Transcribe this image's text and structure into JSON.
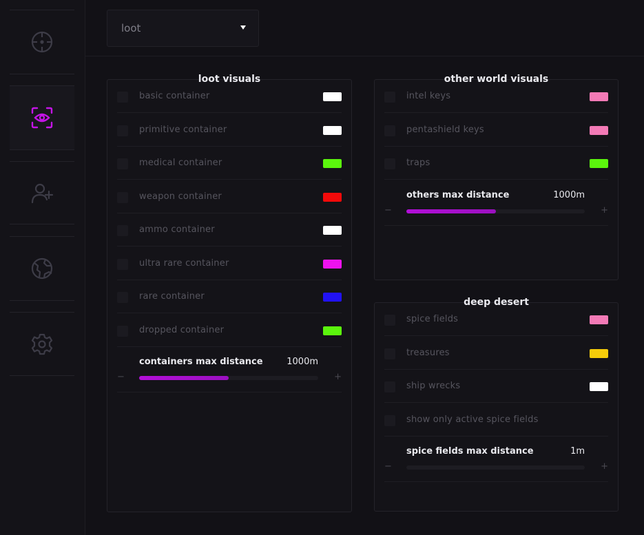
{
  "nav": {
    "items": [
      {
        "icon": "crosshair-icon",
        "active": false
      },
      {
        "icon": "eye-scan-icon",
        "active": true
      },
      {
        "icon": "user-plus-icon",
        "active": false
      },
      {
        "icon": "globe-icon",
        "active": false
      },
      {
        "icon": "gear-icon",
        "active": false
      }
    ],
    "active_color": "#c414e6",
    "inactive_color": "#3d3c47"
  },
  "dropdown": {
    "selected": "loot"
  },
  "loot_visuals": {
    "title": "loot visuals",
    "items": [
      {
        "label": "basic container",
        "color": "#ffffff"
      },
      {
        "label": "primitive container",
        "color": "#ffffff"
      },
      {
        "label": "medical container",
        "color": "#5bf50d"
      },
      {
        "label": "weapon container",
        "color": "#f20a0a"
      },
      {
        "label": "ammo container",
        "color": "#ffffff"
      },
      {
        "label": "ultra rare container",
        "color": "#ee12ee"
      },
      {
        "label": "rare container",
        "color": "#2112f5"
      },
      {
        "label": "dropped container",
        "color": "#5bf50d"
      }
    ],
    "slider": {
      "label": "containers max distance",
      "value": "1000m",
      "fill_fraction": 0.5,
      "minus": "−",
      "plus": "+"
    }
  },
  "other_world_visuals": {
    "title": "other world visuals",
    "items": [
      {
        "label": "intel keys",
        "color": "#f37ab6"
      },
      {
        "label": "pentashield keys",
        "color": "#f37ab6"
      },
      {
        "label": "traps",
        "color": "#5bf50d"
      }
    ],
    "slider": {
      "label": "others max distance",
      "value": "1000m",
      "fill_fraction": 0.5,
      "minus": "−",
      "plus": "+"
    }
  },
  "deep_desert": {
    "title": "deep desert",
    "items": [
      {
        "label": "spice fields",
        "color": "#f37ab6"
      },
      {
        "label": "treasures",
        "color": "#f5cc0a"
      },
      {
        "label": "ship wrecks",
        "color": "#ffffff"
      },
      {
        "label": "show only active spice fields",
        "color": ""
      }
    ],
    "slider": {
      "label": "spice fields max distance",
      "value": "1m",
      "fill_fraction": 0.0,
      "minus": "−",
      "plus": "+"
    }
  }
}
